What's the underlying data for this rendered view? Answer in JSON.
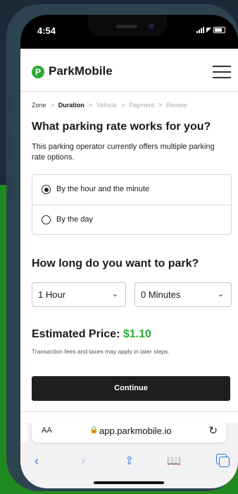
{
  "status_bar": {
    "time": "4:54"
  },
  "header": {
    "logo_mark": "P",
    "brand": "ParkMobile"
  },
  "breadcrumb": {
    "items": [
      {
        "label": "Zone"
      },
      {
        "label": "Duration"
      },
      {
        "label": "Vehicle"
      },
      {
        "label": "Payment"
      },
      {
        "label": "Review"
      }
    ],
    "separator": ">"
  },
  "rate": {
    "title": "What parking rate works for you?",
    "description": "This parking operator currently offers multiple parking rate options.",
    "options": [
      {
        "label": "By the hour and the minute",
        "selected": true
      },
      {
        "label": "By the day",
        "selected": false
      }
    ]
  },
  "duration": {
    "title": "How long do you want to park?",
    "hours_value": "1 Hour",
    "minutes_value": "0 Minutes"
  },
  "price": {
    "label": "Estimated Price:",
    "amount": "$1.10",
    "note": "Transaction fees and taxes may apply in later steps."
  },
  "continue_label": "Continue",
  "browser": {
    "aa_label": "AA",
    "url": "app.parkmobile.io"
  },
  "colors": {
    "brand_green": "#2daa3a",
    "button_dark": "#1f1f1f",
    "safari_blue": "#2a74d8"
  }
}
